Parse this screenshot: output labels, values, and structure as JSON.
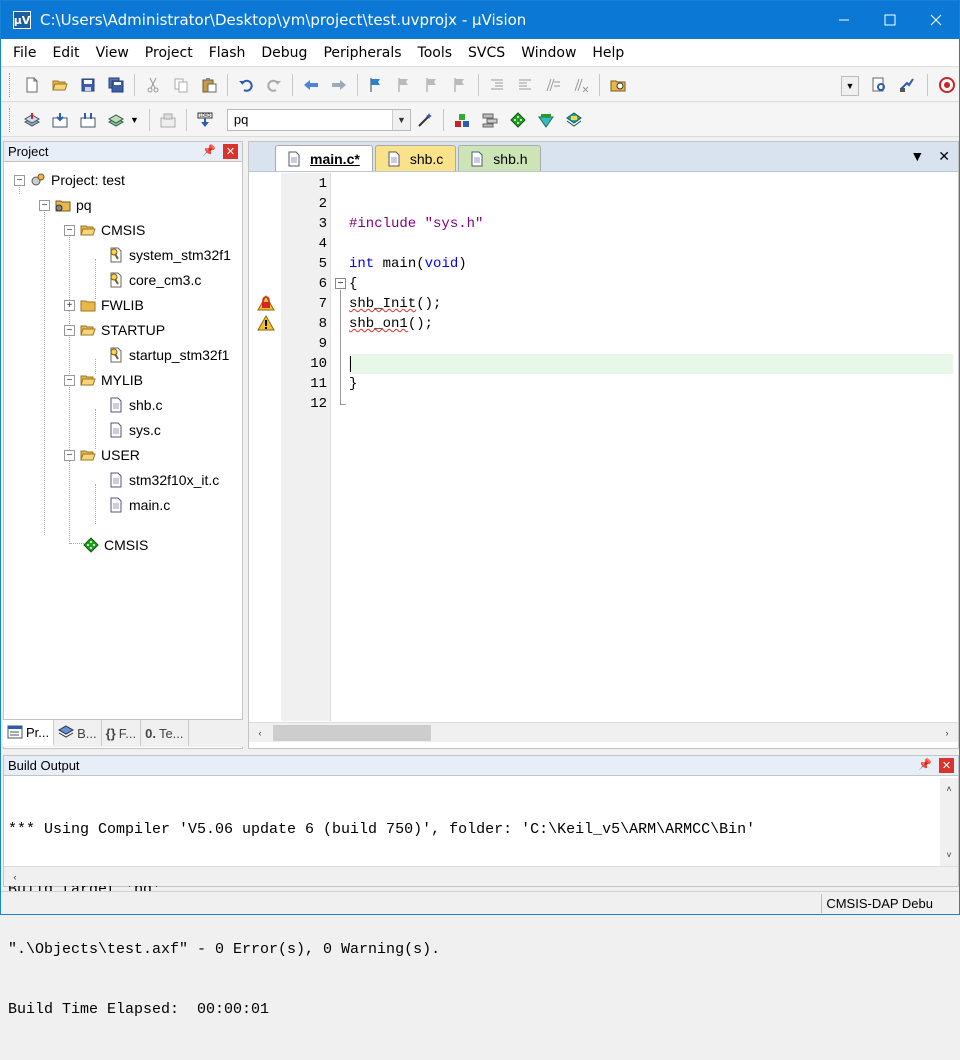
{
  "window": {
    "title": "C:\\Users\\Administrator\\Desktop\\ym\\project\\test.uvprojx - µVision",
    "app_icon": "µV"
  },
  "menu": [
    "File",
    "Edit",
    "View",
    "Project",
    "Flash",
    "Debug",
    "Peripherals",
    "Tools",
    "SVCS",
    "Window",
    "Help"
  ],
  "toolbar2": {
    "target": "pq"
  },
  "project_pane": {
    "title": "Project",
    "tree": [
      {
        "label": "Project: test"
      },
      {
        "label": "pq"
      },
      {
        "label": "CMSIS"
      },
      {
        "label": "system_stm32f1"
      },
      {
        "label": "core_cm3.c"
      },
      {
        "label": "FWLIB"
      },
      {
        "label": "STARTUP"
      },
      {
        "label": "startup_stm32f1"
      },
      {
        "label": "MYLIB"
      },
      {
        "label": "shb.c"
      },
      {
        "label": "sys.c"
      },
      {
        "label": "USER"
      },
      {
        "label": "stm32f10x_it.c"
      },
      {
        "label": "main.c"
      },
      {
        "label": "CMSIS"
      }
    ],
    "tabs": [
      "Pr...",
      "B...",
      "F...",
      "Te..."
    ]
  },
  "editor": {
    "tabs": [
      "main.c*",
      "shb.c",
      "shb.h"
    ],
    "line_numbers": [
      "1",
      "2",
      "3",
      "4",
      "5",
      "6",
      "7",
      "8",
      "9",
      "10",
      "11",
      "12"
    ],
    "code": {
      "line3_pp": "#include",
      "line3_str": "\"sys.h\"",
      "line5_kw1": "int",
      "line5_name": " main",
      "line5_paren_open": "(",
      "line5_kw2": "void",
      "line5_paren_close": ")",
      "line6": "{",
      "line7_fn": "shb_Init",
      "line7_rest": "();",
      "line8_fn": "shb_on1",
      "line8_rest": "();",
      "line11": "}"
    }
  },
  "build_output": {
    "title": "Build Output",
    "lines": [
      "*** Using Compiler 'V5.06 update 6 (build 750)', folder: 'C:\\Keil_v5\\ARM\\ARMCC\\Bin'",
      "Build target 'pq'",
      "\".\\Objects\\test.axf\" - 0 Error(s), 0 Warning(s).",
      "Build Time Elapsed:  00:00:01"
    ]
  },
  "status": {
    "debugger": "CMSIS-DAP Debu"
  }
}
